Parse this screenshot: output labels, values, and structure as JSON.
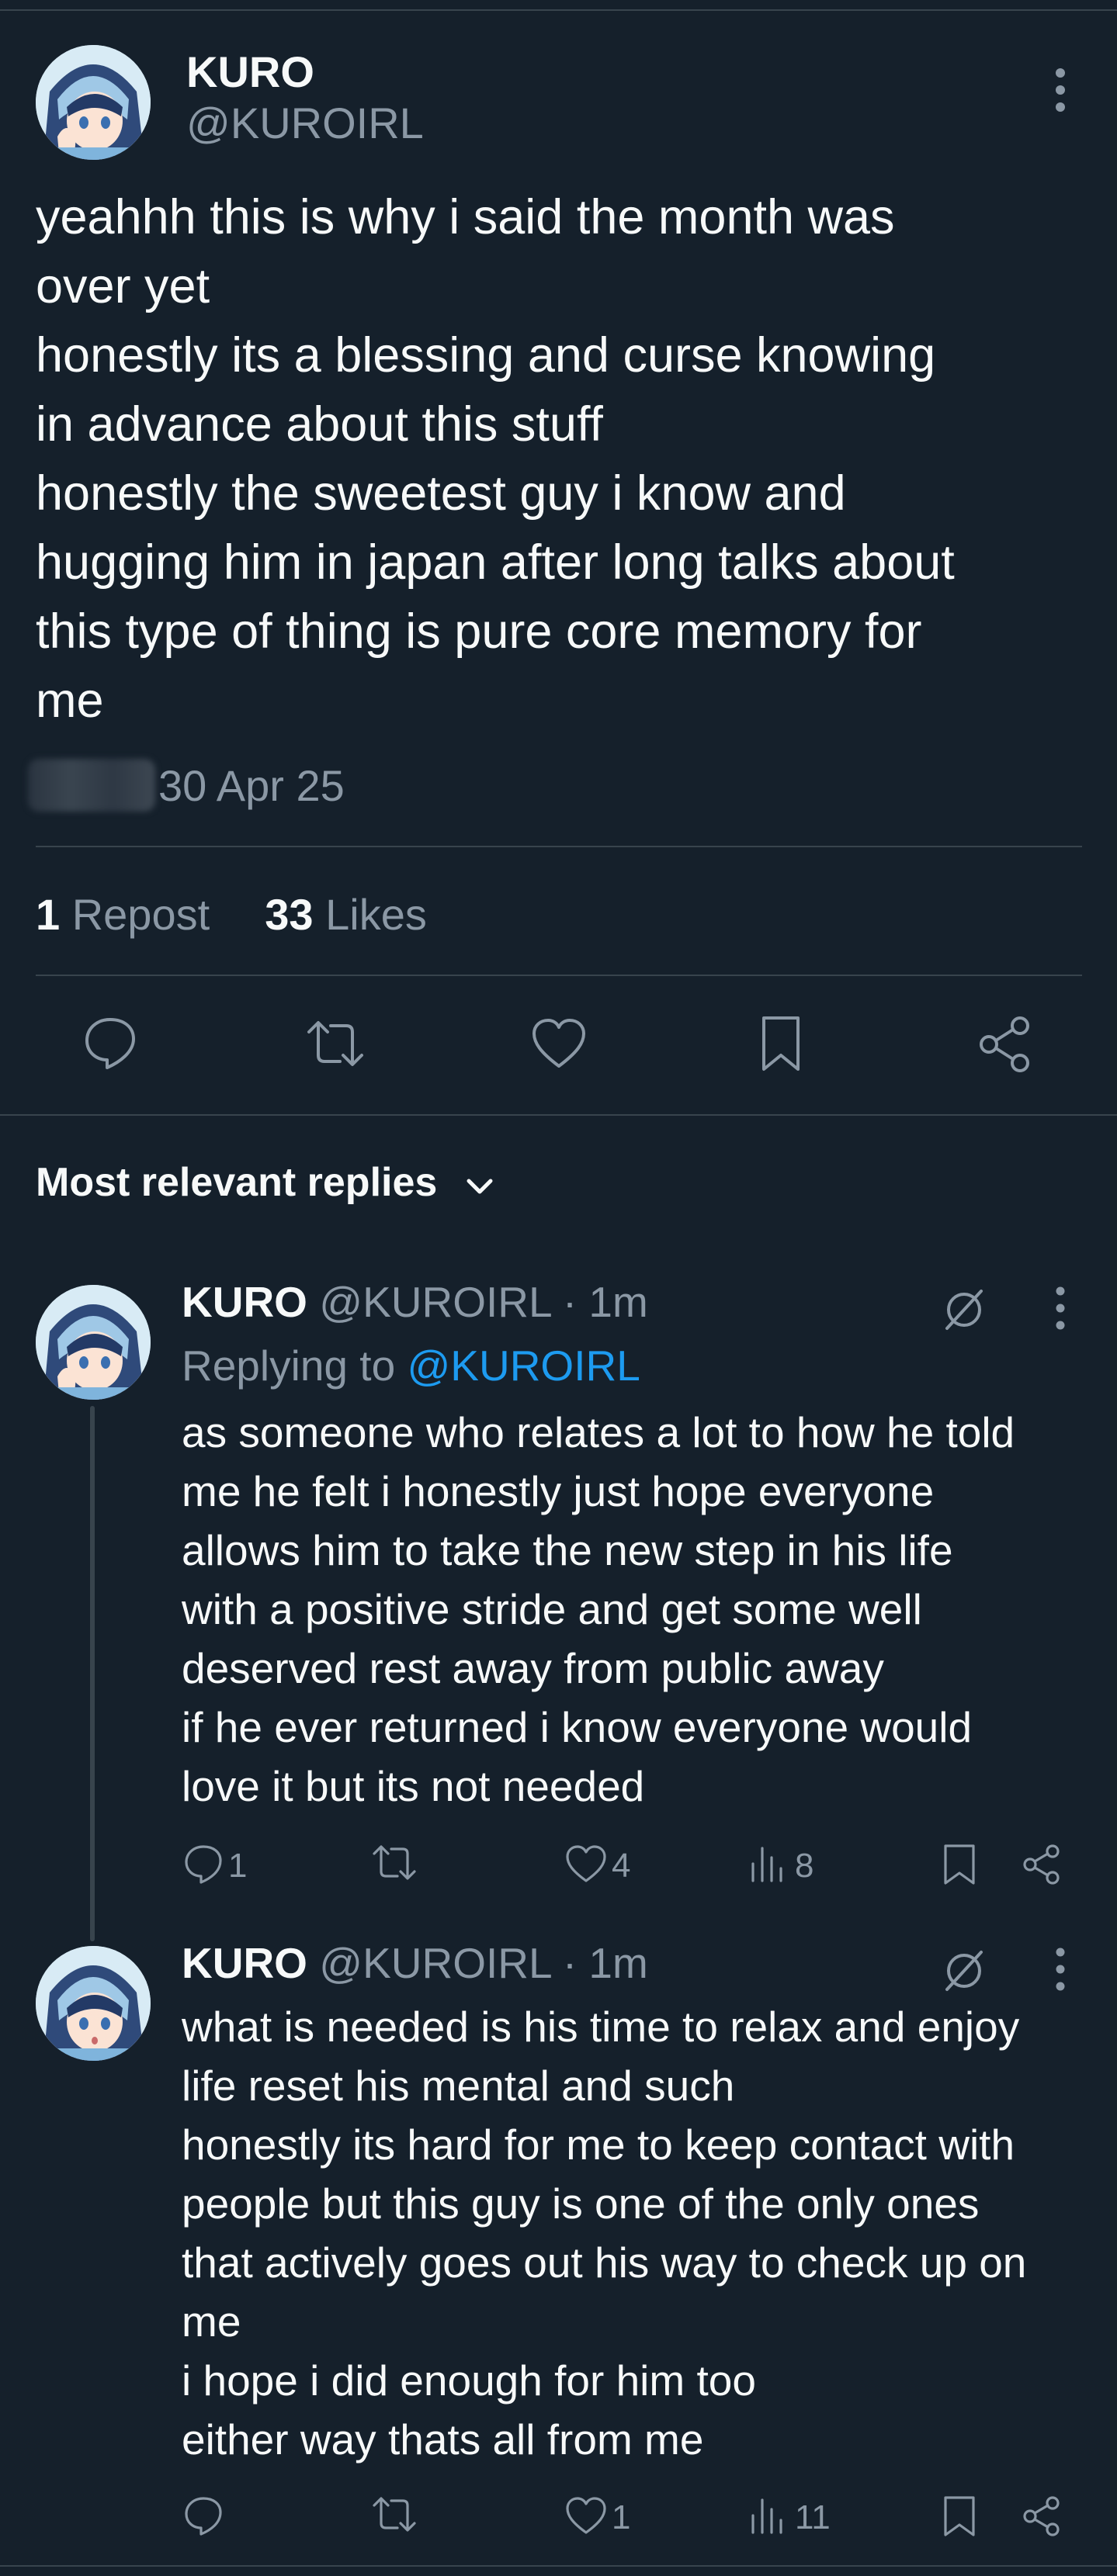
{
  "post": {
    "display_name": "KURO",
    "handle": "@KUROIRL",
    "text": "yeahhh this is why i said the month was\nover yet\nhonestly its a blessing and curse knowing\nin advance about this stuff\nhonestly the sweetest guy i know and\nhugging him in japan after long talks about\nthis type of thing is pure core memory for\nme",
    "date": "30 Apr 25",
    "repost_count": "1",
    "repost_label": "Repost",
    "like_count": "33",
    "like_label": "Likes"
  },
  "replies_header": "Most relevant replies",
  "replies": [
    {
      "display_name": "KURO",
      "handle": "@KUROIRL",
      "time": "· 1m",
      "replying_prefix": "Replying to",
      "replying_to": "@KUROIRL",
      "text": "as someone who relates a lot to how he told\nme he felt i honestly just hope everyone\nallows him to take the new step in his life\nwith a positive stride and get some well\ndeserved rest away from public away\nif he ever returned i know everyone would\nlove it but its not needed",
      "replies": "1",
      "likes": "4",
      "views": "8"
    },
    {
      "display_name": "KURO",
      "handle": "@KUROIRL",
      "time": "· 1m",
      "text": "what is needed is his time to relax and enjoy\nlife reset his mental and such\nhonestly its hard for me to keep contact with\npeople but this guy is one of the only ones\nthat actively goes out his way to check up on\nme\ni hope i did enough for him too\neither way thats all from me",
      "replies": "",
      "likes": "1",
      "views": "11"
    }
  ],
  "colors": {
    "background": "#15202b",
    "text": "#f7f9f9",
    "muted": "#8b98a5",
    "link": "#1d9bf0",
    "divider": "#38444d"
  },
  "icons": [
    "more-icon",
    "reply-icon",
    "repost-icon",
    "like-icon",
    "bookmark-icon",
    "share-icon",
    "chevron-down-icon",
    "grok-icon",
    "views-icon"
  ]
}
